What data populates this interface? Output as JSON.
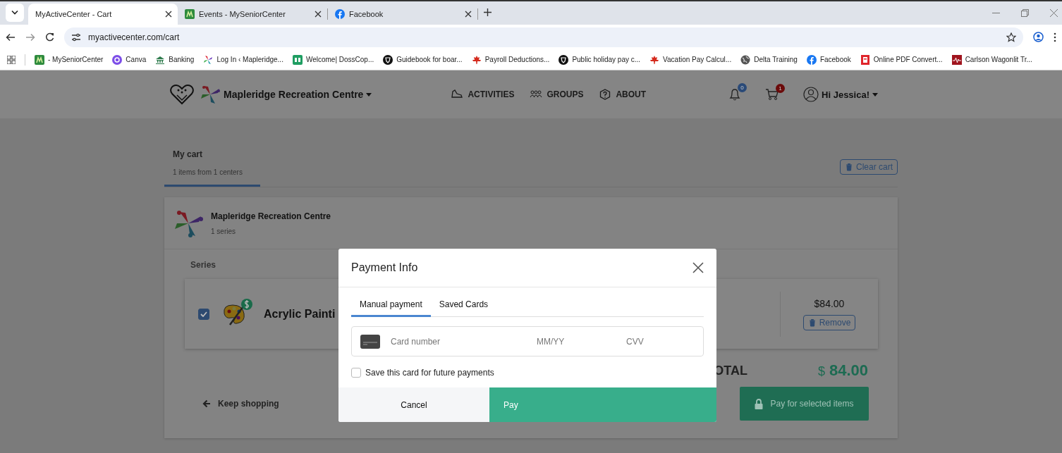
{
  "browser": {
    "tabs": [
      {
        "title": "MyActiveCenter - Cart",
        "selected": true
      },
      {
        "title": "Events - MySeniorCenter",
        "selected": false
      },
      {
        "title": "Facebook",
        "selected": false
      }
    ],
    "address": "myactivecenter.com/cart",
    "bookmarks": [
      "- MySeniorCenter",
      "Canva",
      "Banking",
      "Log In ‹ Mapleridge...",
      "Welcome| DossCop...",
      "Guidebook for boar...",
      "Payroll Deductions...",
      "Public holiday pay c...",
      "Vacation Pay Calcul...",
      "Delta Training",
      "Facebook",
      "Online PDF Convert...",
      "Carlson Wagonlit Tr..."
    ]
  },
  "header": {
    "brand": "Mapleridge Recreation Centre",
    "nav": [
      "ACTIVITIES",
      "GROUPS",
      "ABOUT"
    ],
    "notifications": "0",
    "cart_count": "1",
    "user": "Hi Jessica!"
  },
  "cart": {
    "title": "My cart",
    "subtitle": "1 items from 1 centers",
    "clear": "Clear cart",
    "center": {
      "name": "Mapleridge Recreation Centre",
      "count": "1 series"
    },
    "section": "Series",
    "item": {
      "checked": true,
      "title": "Acrylic Painti",
      "price": "$84.00",
      "remove": "Remove"
    },
    "total_label": "OTAL",
    "currency": "$",
    "total": "84.00",
    "keep_shopping": "Keep shopping",
    "pay": "Pay for selected items"
  },
  "modal": {
    "title": "Payment Info",
    "tabs": [
      {
        "label": "Manual payment",
        "selected": true
      },
      {
        "label": "Saved Cards",
        "selected": false
      }
    ],
    "card_placeholder": "Card number",
    "expiry_placeholder": "MM/YY",
    "cvv_placeholder": "CVV",
    "save_label": "Save this card for future payments",
    "save_checked": false,
    "cancel": "Cancel",
    "pay": "Pay"
  }
}
